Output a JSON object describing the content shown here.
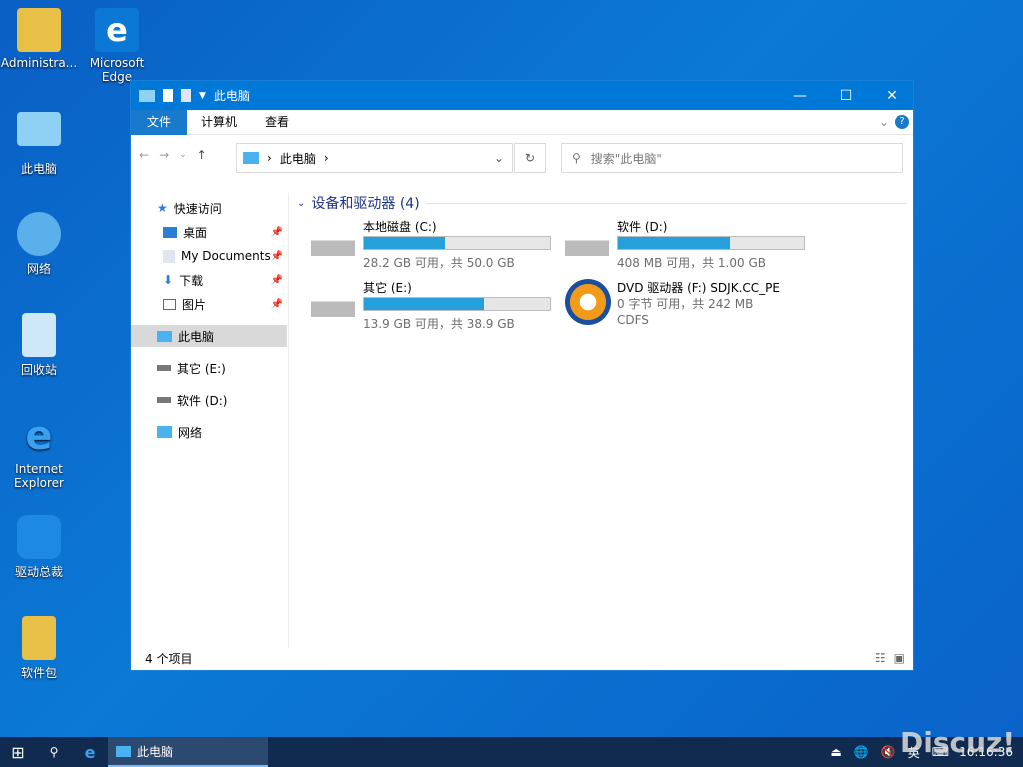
{
  "desktop": {
    "icons": [
      {
        "label": "Administra..."
      },
      {
        "label": "Microsoft Edge"
      },
      {
        "label": "此电脑"
      },
      {
        "label": "网络"
      },
      {
        "label": "回收站"
      },
      {
        "label": "Internet Explorer"
      },
      {
        "label": "驱动总裁"
      },
      {
        "label": "软件包"
      }
    ]
  },
  "window": {
    "title": "此电脑",
    "ribbon_tabs": [
      "文件",
      "计算机",
      "查看"
    ],
    "address": {
      "crumb": "此电脑"
    },
    "search_placeholder": "搜索\"此电脑\"",
    "sidebar": {
      "quick_access": "快速访问",
      "items": [
        "桌面",
        "My Documents",
        "下载",
        "图片"
      ],
      "this_pc": "此电脑",
      "drives": [
        "其它 (E:)",
        "软件 (D:)"
      ],
      "network": "网络"
    },
    "group_title": "设备和驱动器 (4)",
    "drives": [
      {
        "name": "本地磁盘 (C:)",
        "size": "28.2 GB 可用，共 50.0 GB",
        "used_fraction": 0.436
      },
      {
        "name": "软件 (D:)",
        "size": "408 MB 可用，共 1.00 GB",
        "used_fraction": 0.6
      },
      {
        "name": "其它 (E:)",
        "size": "13.9 GB 可用，共 38.9 GB",
        "used_fraction": 0.643
      },
      {
        "name": "DVD 驱动器 (F:) SDJK.CC_PE",
        "size": "0 字节 可用，共 242 MB",
        "fs": "CDFS"
      }
    ],
    "status": "4 个项目"
  },
  "taskbar": {
    "app": "此电脑",
    "ime": "英",
    "time": "16:16:36",
    "watermark": "Discuz!"
  },
  "colors": {
    "accent": "#0078d7",
    "bar": "#26a0da"
  }
}
